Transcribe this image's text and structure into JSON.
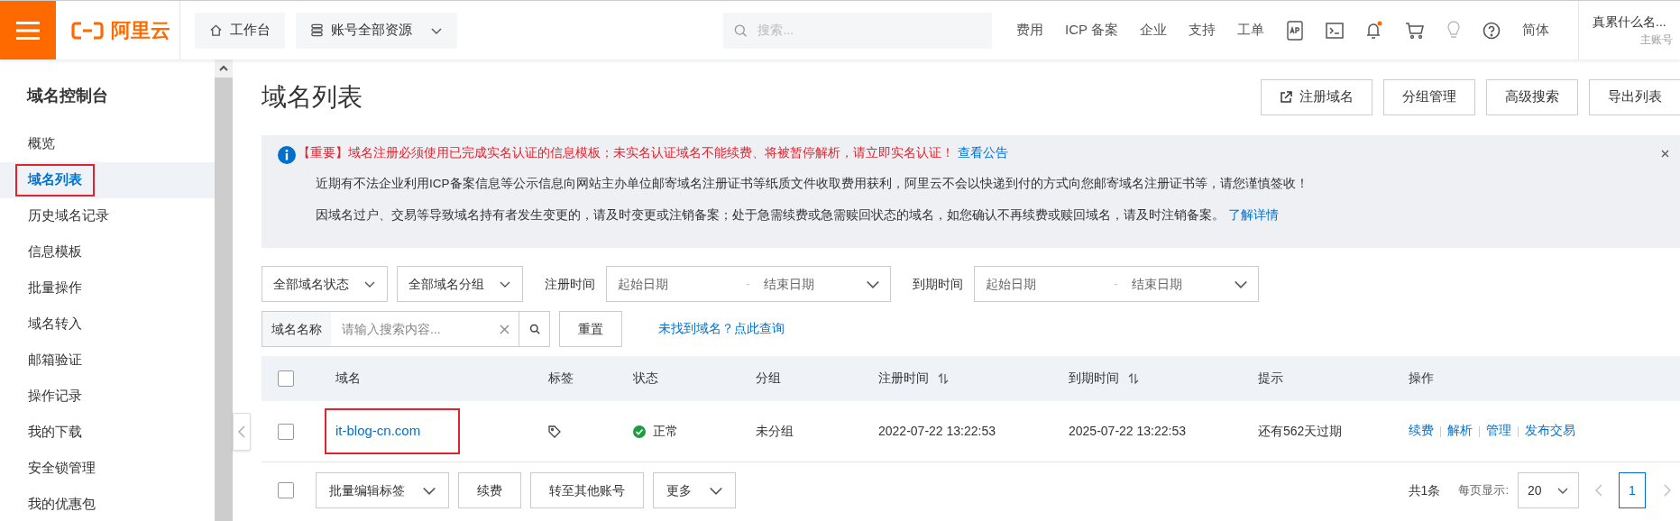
{
  "header": {
    "logo": "阿里云",
    "nav": [
      {
        "kind": "home",
        "label": "工作台"
      },
      {
        "kind": "resources",
        "label": "账号全部资源"
      }
    ],
    "search": {
      "placeholder": "搜索..."
    },
    "links": [
      "费用",
      "ICP 备案",
      "企业",
      "支持",
      "工单"
    ],
    "bell_unread": true,
    "language": "简体",
    "user": {
      "name": "真累什么名...",
      "role": "主账号"
    }
  },
  "sidebar": {
    "title": "域名控制台",
    "items": [
      {
        "label": "概览",
        "selected": false,
        "highlighted": false
      },
      {
        "label": "域名列表",
        "selected": true,
        "highlighted": true
      },
      {
        "label": "历史域名记录",
        "selected": false,
        "highlighted": false
      },
      {
        "label": "信息模板",
        "selected": false,
        "highlighted": false
      },
      {
        "label": "批量操作",
        "selected": false,
        "highlighted": false
      },
      {
        "label": "域名转入",
        "selected": false,
        "highlighted": false
      },
      {
        "label": "邮箱验证",
        "selected": false,
        "highlighted": false
      },
      {
        "label": "操作记录",
        "selected": false,
        "highlighted": false
      },
      {
        "label": "我的下载",
        "selected": false,
        "highlighted": false
      },
      {
        "label": "安全锁管理",
        "selected": false,
        "highlighted": false
      },
      {
        "label": "我的优惠包",
        "selected": false,
        "highlighted": false
      }
    ]
  },
  "page": {
    "title": "域名列表",
    "actions": [
      {
        "label": "注册域名",
        "kind": "external"
      },
      {
        "label": "分组管理",
        "kind": "plain"
      },
      {
        "label": "高级搜索",
        "kind": "plain"
      },
      {
        "label": "导出列表",
        "kind": "plain"
      }
    ]
  },
  "notice": {
    "important": "【重要】域名注册必须使用已完成实名认证的信息模板；未实名认证域名不能续费、将被暂停解析，请立即实名认证！",
    "important_link": "查看公告",
    "lines": [
      {
        "text": "近期有不法企业利用ICP备案信息等公示信息向网站主办单位邮寄域名注册证书等纸质文件收取费用获利，阿里云不会以快递到付的方式向您邮寄域名注册证书等，请您谨慎签收！"
      },
      {
        "text": "因域名过户、交易等导致域名持有者发生变更的，请及时变更或注销备案；处于急需续费或急需赎回状态的域名，如您确认不再续费或赎回域名，请及时注销备案。",
        "link": "了解详情"
      }
    ]
  },
  "filters": {
    "status": "全部域名状态",
    "group": "全部域名分组",
    "ranges": [
      {
        "label": "注册时间",
        "start": "起始日期",
        "separator": "-",
        "end": "结束日期"
      },
      {
        "label": "到期时间",
        "start": "起始日期",
        "separator": "-",
        "end": "结束日期"
      }
    ],
    "search": {
      "label": "域名名称",
      "placeholder": "请输入搜索内容..."
    },
    "reset": "重置",
    "not_found_link": "未找到域名？点此查询"
  },
  "table": {
    "all_checked": false,
    "columns": [
      {
        "label": "域名",
        "sortable": false
      },
      {
        "label": "标签",
        "sortable": false
      },
      {
        "label": "状态",
        "sortable": false
      },
      {
        "label": "分组",
        "sortable": false
      },
      {
        "label": "注册时间",
        "sortable": true
      },
      {
        "label": "到期时间",
        "sortable": true
      },
      {
        "label": "提示",
        "sortable": false
      },
      {
        "label": "操作",
        "sortable": false
      }
    ],
    "rows": [
      {
        "checked": false,
        "domain": "it-blog-cn.com",
        "highlighted": true,
        "status": "正常",
        "group": "未分组",
        "registered": "2022-07-22 13:22:53",
        "expires": "2025-07-22 13:22:53",
        "hint": "还有562天过期",
        "actions": [
          "续费",
          "解析",
          "管理",
          "发布交易"
        ]
      }
    ]
  },
  "footer": {
    "all_checked": false,
    "batch": [
      {
        "kind": "select",
        "label": "批量编辑标签"
      },
      {
        "kind": "button",
        "label": "续费"
      },
      {
        "kind": "button",
        "label": "转至其他账号"
      },
      {
        "kind": "select",
        "label": "更多"
      }
    ],
    "total": "共1条",
    "page_size_label": "每页显示:",
    "page_size": "20",
    "pages": [
      {
        "label": "1",
        "selected": true
      }
    ]
  }
}
